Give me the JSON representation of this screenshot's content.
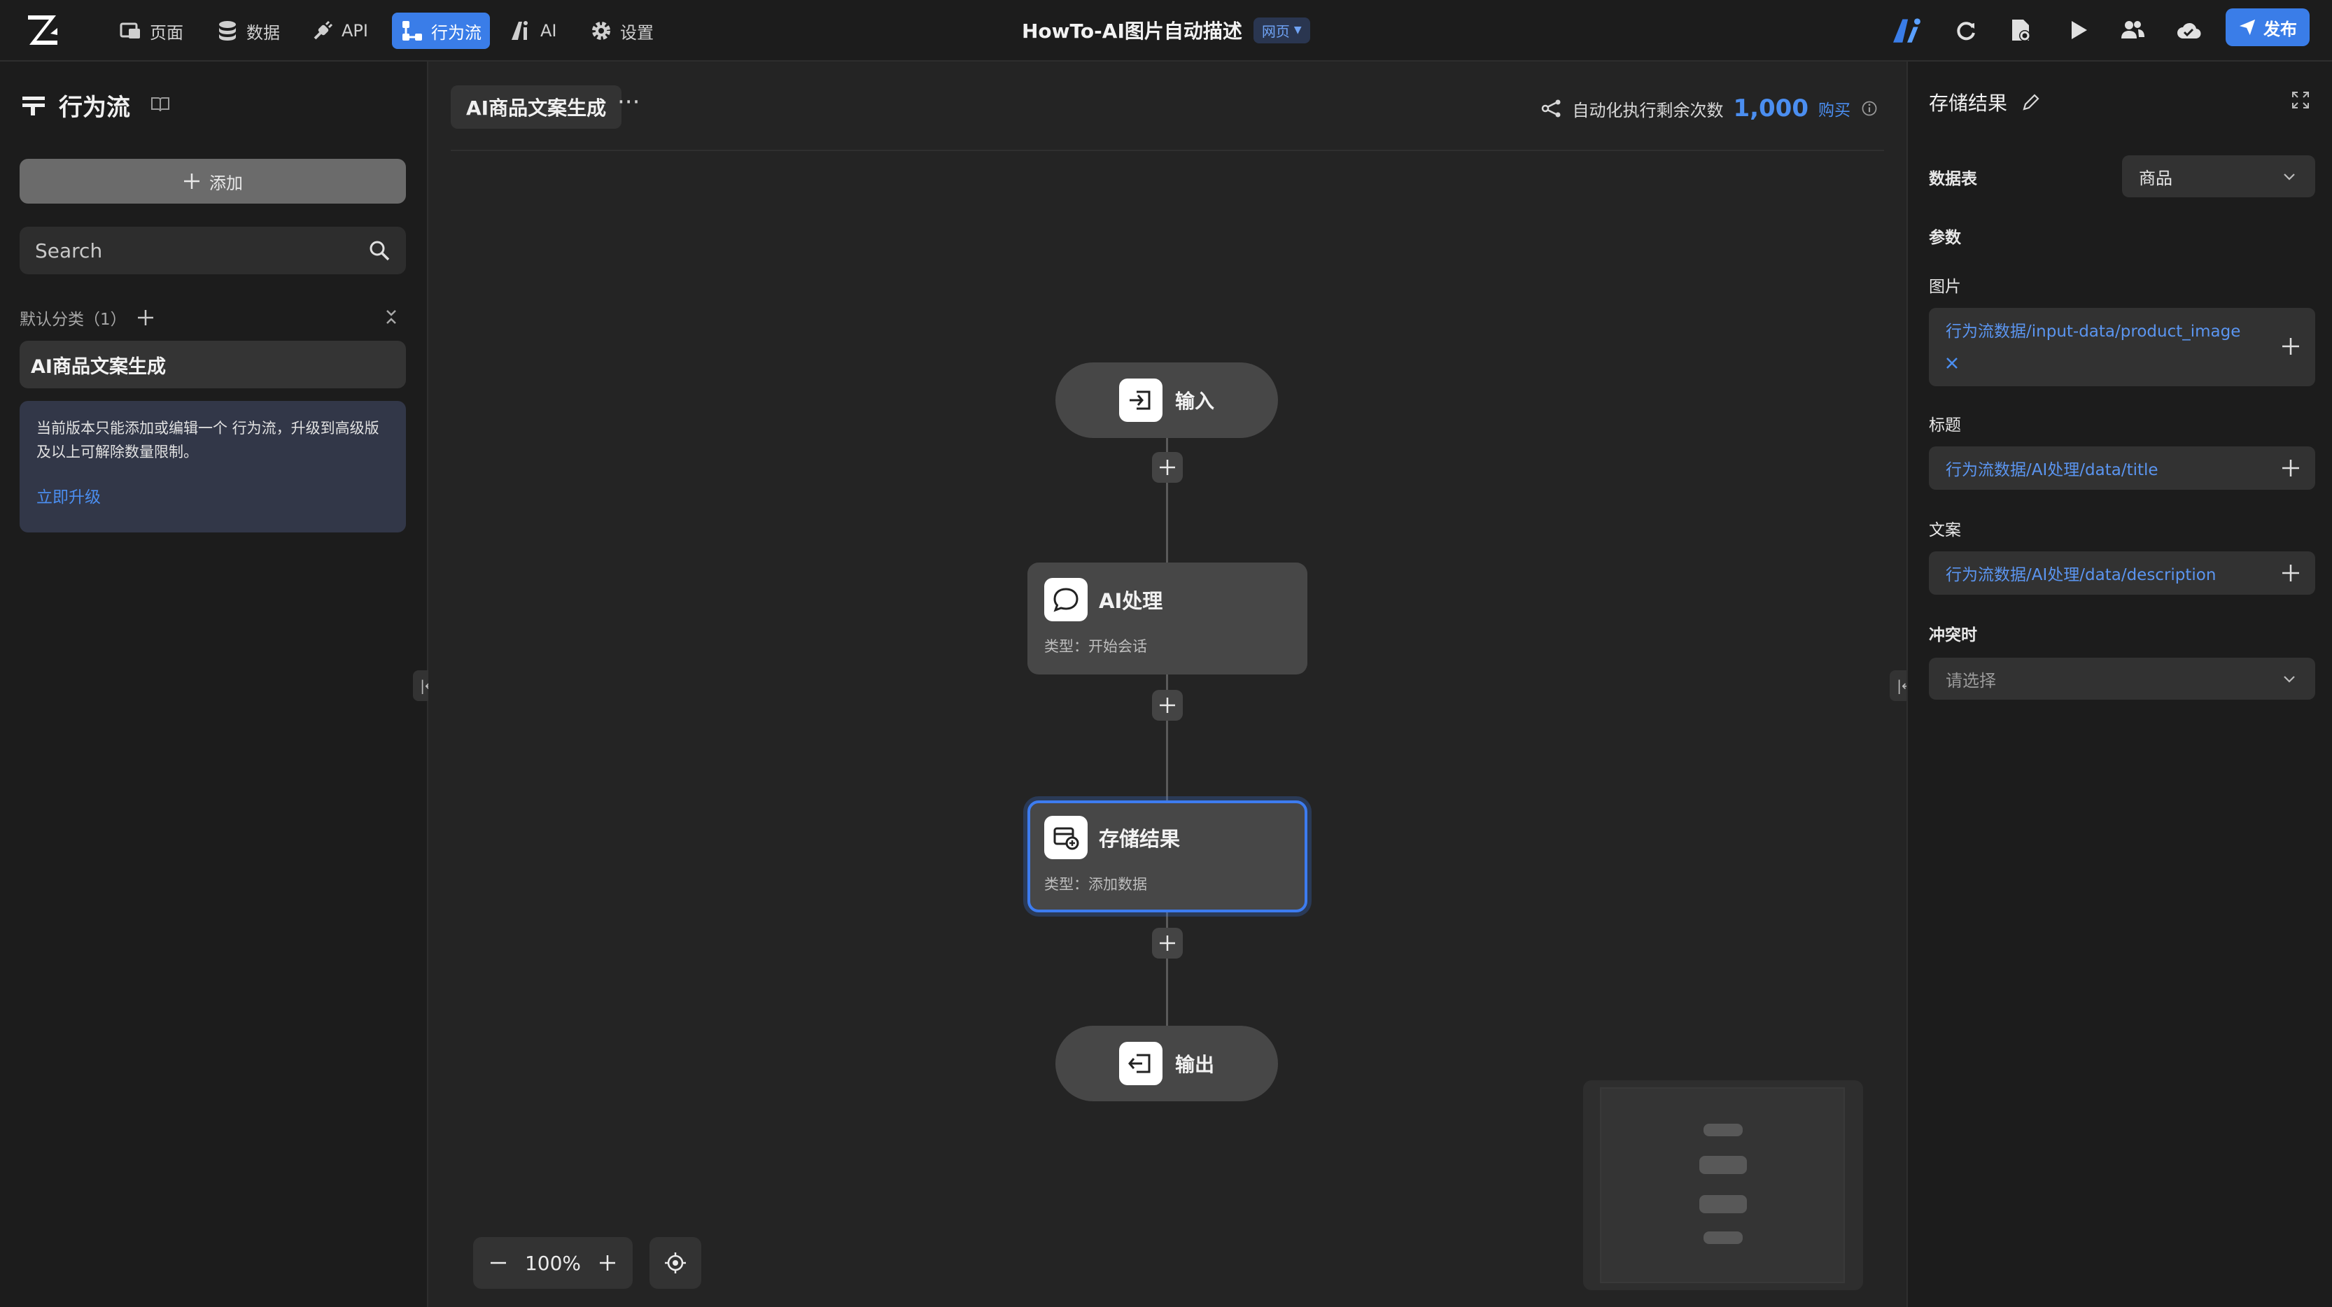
{
  "topbar": {
    "nav": [
      {
        "label": "页面",
        "icon": "pages-icon"
      },
      {
        "label": "数据",
        "icon": "database-icon"
      },
      {
        "label": "API",
        "icon": "api-plug-icon"
      },
      {
        "label": "行为流",
        "icon": "workflow-icon",
        "active": true
      },
      {
        "label": "AI",
        "icon": "ai-icon"
      },
      {
        "label": "设置",
        "icon": "gear-icon"
      }
    ],
    "app_title": "HowTo-AI图片自动描述",
    "app_badge": "网页",
    "publish_label": "发布"
  },
  "sidebar": {
    "title": "行为流",
    "add_label": "添加",
    "search_placeholder": "Search",
    "category_label": "默认分类（1）",
    "flow_item": "AI商品文案生成",
    "notice_text": "当前版本只能添加或编辑一个 行为流，升级到高级版及以上可解除数量限制。",
    "notice_link": "立即升级"
  },
  "canvas": {
    "flow_tab": "AI商品文案生成",
    "remaining_label": "自动化执行剩余次数",
    "remaining_count": "1,000",
    "buy_label": "购买",
    "zoom": "100%",
    "nodes": {
      "input": {
        "label": "输入"
      },
      "ai": {
        "title": "AI处理",
        "subtitle": "类型：开始会话"
      },
      "store": {
        "title": "存储结果",
        "subtitle": "类型：添加数据"
      },
      "output": {
        "label": "输出"
      }
    }
  },
  "panel": {
    "title": "存储结果",
    "table_label": "数据表",
    "table_value": "商品",
    "params_label": "参数",
    "image_label": "图片",
    "image_value": "行为流数据/input-data/product_image",
    "title_label": "标题",
    "title_value": "行为流数据/AI处理/data/title",
    "copy_label": "文案",
    "copy_value": "行为流数据/AI处理/data/description",
    "conflict_label": "冲突时",
    "conflict_placeholder": "请选择"
  },
  "colors": {
    "accent": "#3a7de8",
    "link": "#4b8ef0",
    "node_bg": "#474747",
    "selected_border": "#3d7cf0"
  }
}
